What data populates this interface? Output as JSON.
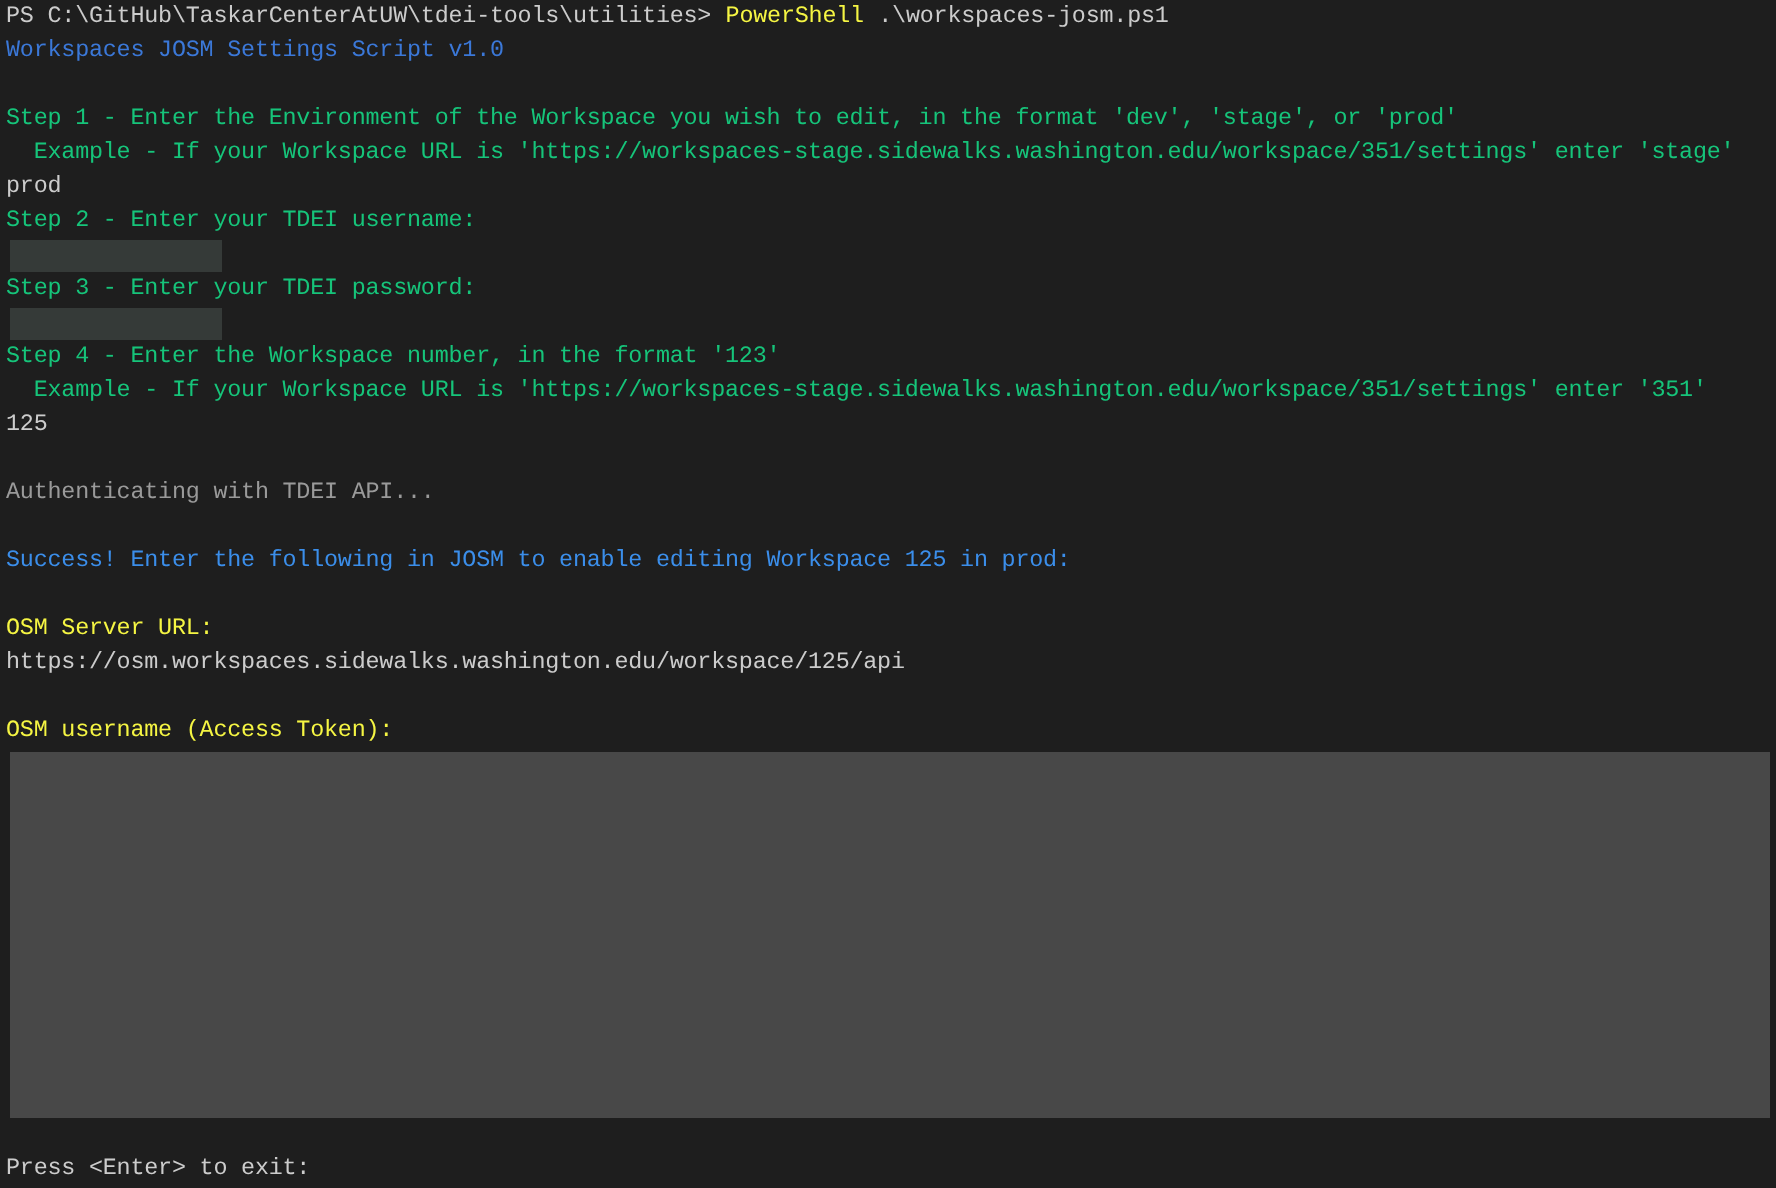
{
  "terminal": {
    "lines": [
      {
        "kind": "prompt",
        "prompt": "PS C:\\GitHub\\TaskarCenterAtUW\\tdei-tools\\utilities>",
        "command": "PowerShell",
        "argument": ".\\workspaces-josm.ps1"
      },
      {
        "kind": "heading",
        "text": "Workspaces JOSM Settings Script v1.0"
      },
      {
        "kind": "blank"
      },
      {
        "kind": "step",
        "text": "Step 1 - Enter the Environment of the Workspace you wish to edit, in the format 'dev', 'stage', or 'prod'"
      },
      {
        "kind": "step",
        "text": "  Example - If your Workspace URL is 'https://workspaces-stage.sidewalks.washington.edu/workspace/351/settings' enter 'stage'"
      },
      {
        "kind": "input",
        "text": "prod"
      },
      {
        "kind": "step",
        "text": "Step 2 - Enter your TDEI username:"
      },
      {
        "kind": "masked"
      },
      {
        "kind": "step",
        "text": "Step 3 - Enter your TDEI password:"
      },
      {
        "kind": "masked"
      },
      {
        "kind": "step",
        "text": "Step 4 - Enter the Workspace number, in the format '123'"
      },
      {
        "kind": "step",
        "text": "  Example - If your Workspace URL is 'https://workspaces-stage.sidewalks.washington.edu/workspace/351/settings' enter '351'"
      },
      {
        "kind": "input",
        "text": "125"
      },
      {
        "kind": "blank"
      },
      {
        "kind": "status",
        "text": "Authenticating with TDEI API..."
      },
      {
        "kind": "blank"
      },
      {
        "kind": "success",
        "text": "Success! Enter the following in JOSM to enable editing Workspace 125 in prod:"
      },
      {
        "kind": "blank"
      },
      {
        "kind": "label",
        "text": "OSM Server URL:"
      },
      {
        "kind": "input",
        "text": "https://osm.workspaces.sidewalks.washington.edu/workspace/125/api"
      },
      {
        "kind": "blank"
      },
      {
        "kind": "label",
        "text": "OSM username (Access Token):"
      },
      {
        "kind": "masked_block"
      },
      {
        "kind": "blank"
      },
      {
        "kind": "input",
        "text": "Press <Enter> to exit:"
      }
    ]
  }
}
